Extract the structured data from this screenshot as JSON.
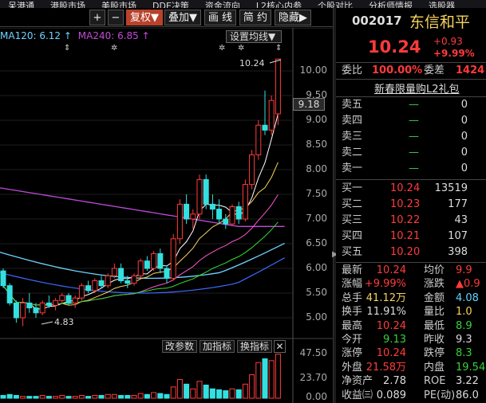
{
  "menu": [
    "呆港通",
    "港股市场",
    "美股市场",
    "DDE决策",
    "资金流向",
    "L2核心内参",
    "个股对比",
    "分析师情报",
    "选股器"
  ],
  "toolbar": {
    "plus": "+",
    "minus": "−",
    "adjust": "复权▼",
    "overlay": "叠加▼",
    "draw": "画 线",
    "simple": "简 约",
    "hide": "隐藏▶"
  },
  "legend": {
    "ma120": "MA120: 6.12 ↑",
    "ma240": "MA240: 6.85 ↑"
  },
  "settings_label": "设置均线▼",
  "price_axis": [
    "10.00",
    "9.50",
    "9.00",
    "8.50",
    "8.00",
    "7.50",
    "7.00",
    "6.50",
    "6.00",
    "5.50",
    "5.00"
  ],
  "current_price_tag": "9.18",
  "high_annotation": "10.24",
  "low_annotation": "4.83",
  "indicator_buttons": {
    "params": "改参数",
    "add": "加指标",
    "switch": "换指标",
    "close": "✕"
  },
  "volume_axis": [
    "47.50",
    "23.70",
    "0.00"
  ],
  "stock": {
    "code": "002017",
    "name": "东信和平",
    "price": "10.24",
    "change": "+0.93",
    "change_pct": "+9.99%"
  },
  "commission": {
    "ratio_label": "委比",
    "ratio": "100.00%",
    "diff_label": "委差",
    "diff": "1424"
  },
  "notice": "新春限量购L2礼包",
  "order_book": {
    "asks": [
      {
        "label": "卖五",
        "price": "—",
        "qty": "0"
      },
      {
        "label": "卖四",
        "price": "—",
        "qty": "0"
      },
      {
        "label": "卖三",
        "price": "—",
        "qty": "0"
      },
      {
        "label": "卖二",
        "price": "—",
        "qty": "0"
      },
      {
        "label": "卖一",
        "price": "—",
        "qty": "0"
      }
    ],
    "bids": [
      {
        "label": "买一",
        "price": "10.24",
        "qty": "13519"
      },
      {
        "label": "买二",
        "price": "10.23",
        "qty": "177"
      },
      {
        "label": "买三",
        "price": "10.22",
        "qty": "43"
      },
      {
        "label": "买四",
        "price": "10.21",
        "qty": "107"
      },
      {
        "label": "买五",
        "price": "10.20",
        "qty": "398"
      }
    ]
  },
  "stats": [
    {
      "l1": "最新",
      "v1": "10.24",
      "c1": "red",
      "l2": "均价",
      "v2": "9.9",
      "c2": "red"
    },
    {
      "l1": "涨幅",
      "v1": "+9.99%",
      "c1": "red",
      "l2": "涨跌",
      "v2": "▲0.9",
      "c2": "red"
    },
    {
      "l1": "总手",
      "v1": "41.12万",
      "c1": "yellow",
      "l2": "金额",
      "v2": "4.08",
      "c2": "cyan"
    },
    {
      "l1": "换手",
      "v1": "11.91%",
      "c1": "white",
      "l2": "量比",
      "v2": "1.0",
      "c2": "yellow"
    },
    {
      "l1": "最高",
      "v1": "10.24",
      "c1": "red",
      "l2": "最低",
      "v2": "8.9",
      "c2": "green"
    },
    {
      "l1": "今开",
      "v1": "9.13",
      "c1": "green",
      "l2": "昨收",
      "v2": "9.3",
      "c2": "white"
    },
    {
      "l1": "涨停",
      "v1": "10.24",
      "c1": "red",
      "l2": "跌停",
      "v2": "8.3",
      "c2": "green"
    },
    {
      "l1": "外盘",
      "v1": "21.58万",
      "c1": "red",
      "l2": "内盘",
      "v2": "19.54",
      "c2": "green"
    },
    {
      "l1": "净资产",
      "v1": "2.78",
      "c1": "white",
      "l2": "ROE",
      "v2": "3.22",
      "c2": "white"
    },
    {
      "l1": "收益㈢",
      "v1": "0.089",
      "c1": "white",
      "l2": "PE(动)",
      "v2": "86.0",
      "c2": "white"
    }
  ],
  "chart_data": {
    "type": "candlestick",
    "ma_series": [
      {
        "name": "MA120",
        "last": 6.12,
        "color": "#6fd3ff"
      },
      {
        "name": "MA240",
        "last": 6.85,
        "color": "#c04bd8"
      }
    ],
    "price_range": [
      4.7,
      10.3
    ],
    "volume_range": [
      0,
      47.5
    ],
    "candles": [
      [
        5.95,
        6.0,
        5.6,
        5.65
      ],
      [
        5.65,
        5.7,
        5.25,
        5.3
      ],
      [
        5.3,
        5.35,
        4.9,
        5.0
      ],
      [
        5.0,
        5.4,
        4.83,
        5.3
      ],
      [
        5.3,
        5.5,
        5.1,
        5.2
      ],
      [
        5.2,
        5.3,
        5.0,
        5.1
      ],
      [
        5.1,
        5.35,
        5.05,
        5.3
      ],
      [
        5.3,
        5.45,
        5.2,
        5.25
      ],
      [
        5.25,
        5.4,
        5.15,
        5.35
      ],
      [
        5.35,
        5.5,
        5.3,
        5.45
      ],
      [
        5.45,
        5.5,
        5.25,
        5.3
      ],
      [
        5.3,
        5.45,
        5.2,
        5.4
      ],
      [
        5.4,
        5.7,
        5.35,
        5.65
      ],
      [
        5.65,
        5.75,
        5.5,
        5.55
      ],
      [
        5.55,
        5.8,
        5.5,
        5.75
      ],
      [
        5.75,
        5.85,
        5.6,
        5.65
      ],
      [
        5.65,
        5.9,
        5.6,
        5.85
      ],
      [
        5.85,
        6.1,
        5.8,
        6.0
      ],
      [
        6.0,
        6.1,
        5.7,
        5.75
      ],
      [
        5.75,
        5.85,
        5.6,
        5.7
      ],
      [
        5.7,
        5.9,
        5.65,
        5.85
      ],
      [
        5.85,
        6.2,
        5.8,
        6.15
      ],
      [
        6.15,
        6.25,
        5.95,
        6.0
      ],
      [
        6.0,
        6.35,
        5.95,
        6.3
      ],
      [
        6.3,
        6.4,
        5.9,
        6.0
      ],
      [
        6.0,
        6.05,
        5.7,
        5.8
      ],
      [
        5.8,
        6.7,
        5.75,
        6.6
      ],
      [
        6.6,
        7.4,
        6.5,
        7.3
      ],
      [
        7.3,
        7.5,
        6.9,
        7.0
      ],
      [
        7.0,
        7.2,
        6.8,
        7.1
      ],
      [
        7.1,
        7.9,
        7.0,
        7.8
      ],
      [
        7.8,
        7.9,
        7.2,
        7.3
      ],
      [
        7.3,
        7.5,
        7.0,
        7.2
      ],
      [
        7.2,
        7.4,
        6.9,
        7.0
      ],
      [
        7.0,
        7.1,
        6.8,
        6.9
      ],
      [
        6.9,
        7.3,
        6.85,
        7.25
      ],
      [
        7.25,
        7.35,
        6.9,
        7.0
      ],
      [
        7.0,
        7.8,
        6.95,
        7.7
      ],
      [
        7.7,
        8.4,
        7.6,
        8.3
      ],
      [
        8.3,
        9.0,
        8.2,
        8.9
      ],
      [
        8.9,
        9.6,
        8.7,
        8.8
      ],
      [
        8.8,
        9.5,
        8.7,
        9.4
      ],
      [
        9.13,
        10.24,
        8.9,
        10.24
      ]
    ],
    "volumes": [
      3,
      4,
      3,
      2,
      2,
      2,
      3,
      2,
      2,
      3,
      2,
      2,
      3,
      2,
      3,
      3,
      4,
      4,
      3,
      3,
      3,
      5,
      4,
      6,
      5,
      4,
      12,
      20,
      15,
      10,
      18,
      14,
      10,
      9,
      8,
      10,
      9,
      15,
      25,
      38,
      42,
      40,
      47
    ]
  }
}
